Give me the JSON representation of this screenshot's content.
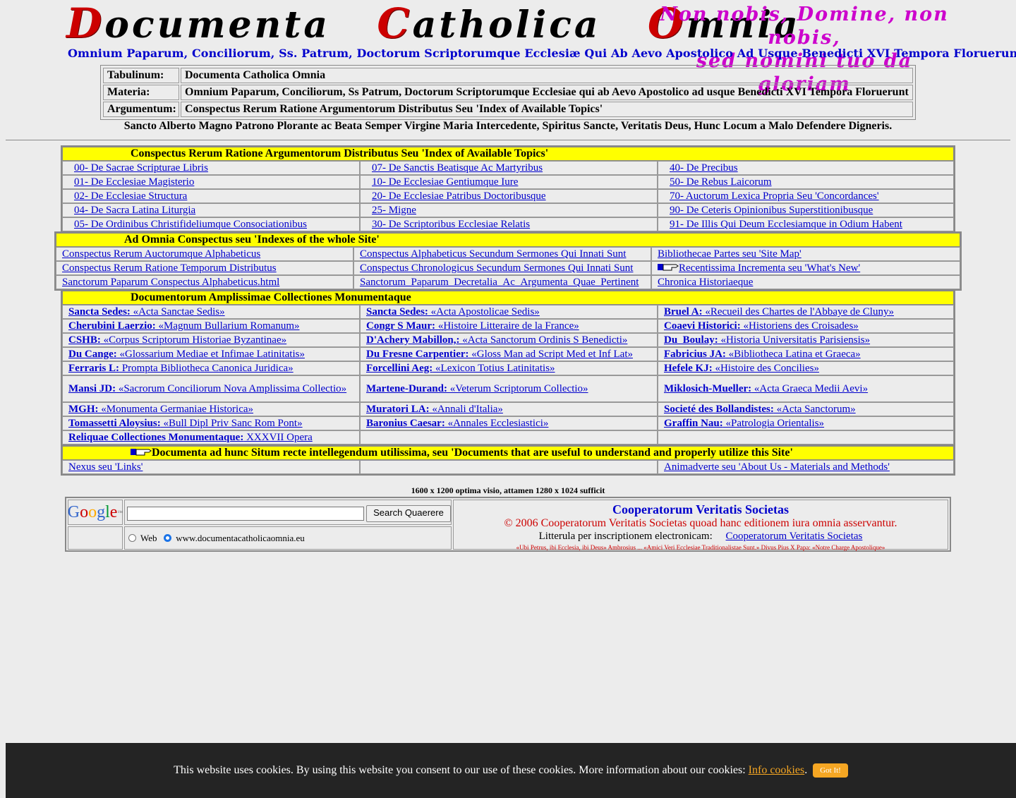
{
  "banner": {
    "title_words": [
      {
        "initial": "D",
        "rest": "ocumenta"
      },
      {
        "initial": "C",
        "rest": "atholica"
      },
      {
        "initial": "O",
        "rest": "mnia"
      }
    ],
    "motto_line1": "Non nobis, Domine, non nobis,",
    "motto_line2": "sed nomini tuo da gloriam",
    "subtitle": "Omnium Paparum, Conciliorum, Ss. Patrum, Doctorum Scriptorumque Ecclesiæ Qui Ab Aevo Apostolico Ad Usque Benedicti XVI Tempora Floruerunt"
  },
  "info": {
    "rows": [
      {
        "key": "Tabulinum:",
        "value": "Documenta Catholica Omnia"
      },
      {
        "key": "Materia:",
        "value": "Omnium Paparum, Conciliorum, Ss Patrum, Doctorum Scriptorumque Ecclesiae qui ab Aevo Apostolico ad usque Benedicti XVI Tempora Floruerunt"
      },
      {
        "key": "Argumentum:",
        "value": "Conspectus Rerum Ratione Argumentorum Distributus Seu 'Index of Available Topics'"
      }
    ]
  },
  "patron_line": "Sancto Alberto Magno Patrono Plorante ac Beata Semper Virgine Maria Intercedente, Spiritus Sancte, Veritatis Deus, Hunc Locum a Malo Defendere Digneris.",
  "topics": {
    "heading": "Conspectus Rerum Ratione Argumentorum Distributus Seu 'Index of Available Topics'",
    "rows": [
      [
        "00- De Sacrae Scripturae Libris",
        "07- De Sanctis Beatisque Ac Martyribus",
        "40- De Precibus"
      ],
      [
        "01- De Ecclesiae Magisterio",
        "10- De Ecclesiae Gentiumque Iure",
        "50- De Rebus Laicorum"
      ],
      [
        "02- De Ecclesiae Structura",
        "20- De Ecclesiae Patribus Doctoribusque",
        "70- Auctorum Lexica Propria Seu 'Concordances'"
      ],
      [
        "04- De Sacra Latina Liturgia",
        "25- Migne",
        "90- De Ceteris Opinionibus Superstitionibusque"
      ],
      [
        "05- De Ordinibus Christifideliumque Consociationibus",
        "30- De Scriptoribus Ecclesiae Relatis",
        "91- De Illis Qui Deum Ecclesiamque in Odium Habent"
      ]
    ]
  },
  "indexes": {
    "heading": "Ad Omnia Conspectus seu 'Indexes of the whole Site'",
    "rows": [
      [
        "Conspectus Rerum Auctorumque Alphabeticus",
        "Conspectus Alphabeticus Secundum Sermones Qui Innati Sunt",
        "Bibliothecae Partes seu 'Site Map'"
      ],
      [
        "Conspectus Rerum Ratione Temporum Distributus",
        "Conspectus Chronologicus Secundum Sermones Qui Innati Sunt",
        "Recentissima Incrementa seu 'What's New'"
      ],
      [
        "Sanctorum Paparum Conspectus Alphabeticus.html",
        "Sanctorum_Paparum_Decretalia_Ac_Argumenta_Quae_Pertinent",
        "Chronica Historiaeque"
      ]
    ]
  },
  "collections": {
    "heading": "Documentorum Amplissimae Collectiones Monumentaque",
    "rows": [
      [
        {
          "a": "Sancta Sedes:",
          "b": " «Acta Sanctae Sedis»"
        },
        {
          "a": "Sancta Sedes:",
          "b": " «Acta Apostolicae Sedis»"
        },
        {
          "a": "Bruel A:",
          "b": " «Recueil des Chartes de l'Abbaye de Cluny»"
        }
      ],
      [
        {
          "a": "Cherubini Laerzio:",
          "b": " «Magnum Bullarium Romanum»"
        },
        {
          "a": "Congr S Maur:",
          "b": " «Histoire Litteraire de la France»"
        },
        {
          "a": "Coaevi Historici:",
          "b": " «Historiens des Croisades»"
        }
      ],
      [
        {
          "a": "CSHB:",
          "b": " «Corpus Scriptorum Historiae Byzantinae»"
        },
        {
          "a": "D'Achery Mabillon,:",
          "b": " «Acta Sanctorum Ordinis S Benedicti»"
        },
        {
          "a": "Du_Boulay:",
          "b": " «Historia Universitatis Parisiensis»"
        }
      ],
      [
        {
          "a": "Du Cange:",
          "b": " «Glossarium Mediae et Infimae Latinitatis»"
        },
        {
          "a": "Du Fresne Carpentier:",
          "b": " «Gloss Man ad Script Med et Inf Lat»"
        },
        {
          "a": "Fabricius JA:",
          "b": " «Bibliotheca Latina et Graeca»"
        }
      ],
      [
        {
          "a": "Ferraris L:",
          "b": " Prompta Bibliotheca Canonica Juridica»"
        },
        {
          "a": "Forcellini Aeg:",
          "b": " «Lexicon Totius Latinitatis»"
        },
        {
          "a": "Hefele KJ:",
          "b": " «Histoire des Concilies»"
        }
      ],
      [
        {
          "a": "Mansi JD:",
          "b": " «Sacrorum Conciliorum Nova Amplissima Collectio»"
        },
        {
          "a": "Martene-Durand:",
          "b": " «Veterum Scriptorum Collectio»"
        },
        {
          "a": "Miklosich-Mueller:",
          "b": " «Acta Graeca Medii Aevi»"
        }
      ],
      [
        {
          "a": "MGH:",
          "b": " «Monumenta Germaniae Historica»"
        },
        {
          "a": "Muratori LA:",
          "b": " «Annali d'Italia»"
        },
        {
          "a": "Societé des Bollandistes:",
          "b": " «Acta Sanctorum»"
        }
      ],
      [
        {
          "a": "Tomassetti Aloysius:",
          "b": " «Bull Dipl Priv Sanc Rom Pont»"
        },
        {
          "a": "Baronius Caesar:",
          "b": " «Annales Ecclesiastici»"
        },
        {
          "a": "Graffin Nau:",
          "b": " «Patrologia Orientalis»"
        }
      ],
      [
        {
          "a": "Reliquae Collectiones Monumentaque:",
          "b": " XXXVII Opera"
        },
        {
          "a": "",
          "b": ""
        },
        {
          "a": "",
          "b": ""
        }
      ]
    ]
  },
  "useful": {
    "heading": "Documenta ad hunc Situm recte intellegendum utilissima, seu 'Documents that are useful to understand and properly utilize this Site'",
    "links": [
      "Nexus seu 'Links'",
      "",
      "Animadverte seu 'About Us - Materials and Methods'"
    ]
  },
  "resolution_note": "1600 x 1200 optima visio, attamen 1280 x 1024 sufficit",
  "search": {
    "logo_text": "Google",
    "logo_colors": [
      "#3366cc",
      "#cc0000",
      "#ffaa00",
      "#3366cc",
      "#009933",
      "#cc0000"
    ],
    "button_label": "Search Quaerere",
    "input_value": "",
    "option_web": "Web",
    "option_site": "www.documentacatholicaomnia.eu"
  },
  "copyright": {
    "org": "Cooperatorum Veritatis Societas",
    "notice": "© 2006 Cooperatorum Veritatis Societas quoad hanc editionem iura omnia asservantur.",
    "email_label": "Litterula per inscriptionem electronicam:",
    "email_link": "Cooperatorum Veritatis Societas",
    "quote": "«Ubi Petrus, ibi Ecclesia, ibi Deus» Ambrosius ... «Amici Veri Ecclesiae Traditionalistae Sunt.» Divus Pius X Papa: «Notre Charge Apostolique»"
  },
  "cookie": {
    "text": "This website uses cookies. By using this website you consent to our use of these cookies. More information about our cookies:",
    "info_link": "Info cookies",
    "button": "Got It!"
  }
}
